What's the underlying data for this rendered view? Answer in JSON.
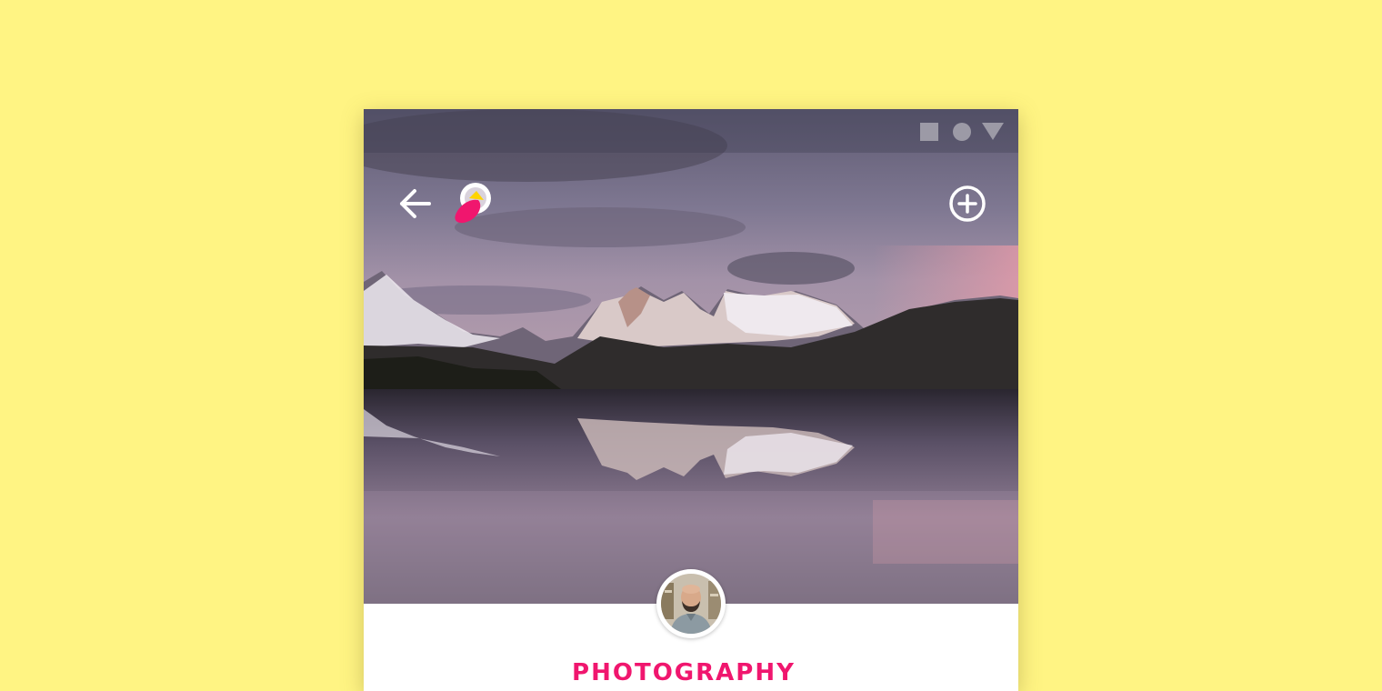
{
  "app": {
    "category": "PHOTOGRAPHY"
  },
  "statusbar": {
    "icons": [
      "square-icon",
      "circle-icon",
      "triangle-icon"
    ]
  },
  "toolbar": {
    "back_icon": "arrow-left-icon",
    "logo": "app-logo",
    "add_icon": "plus-circle-icon"
  },
  "hero": {
    "image": "mountain-lake-landscape"
  },
  "profile": {
    "avatar": "user-avatar"
  },
  "colors": {
    "background": "#FFF483",
    "accent": "#F0166E",
    "logo_yellow": "#FFD400",
    "white": "#FFFFFF"
  }
}
